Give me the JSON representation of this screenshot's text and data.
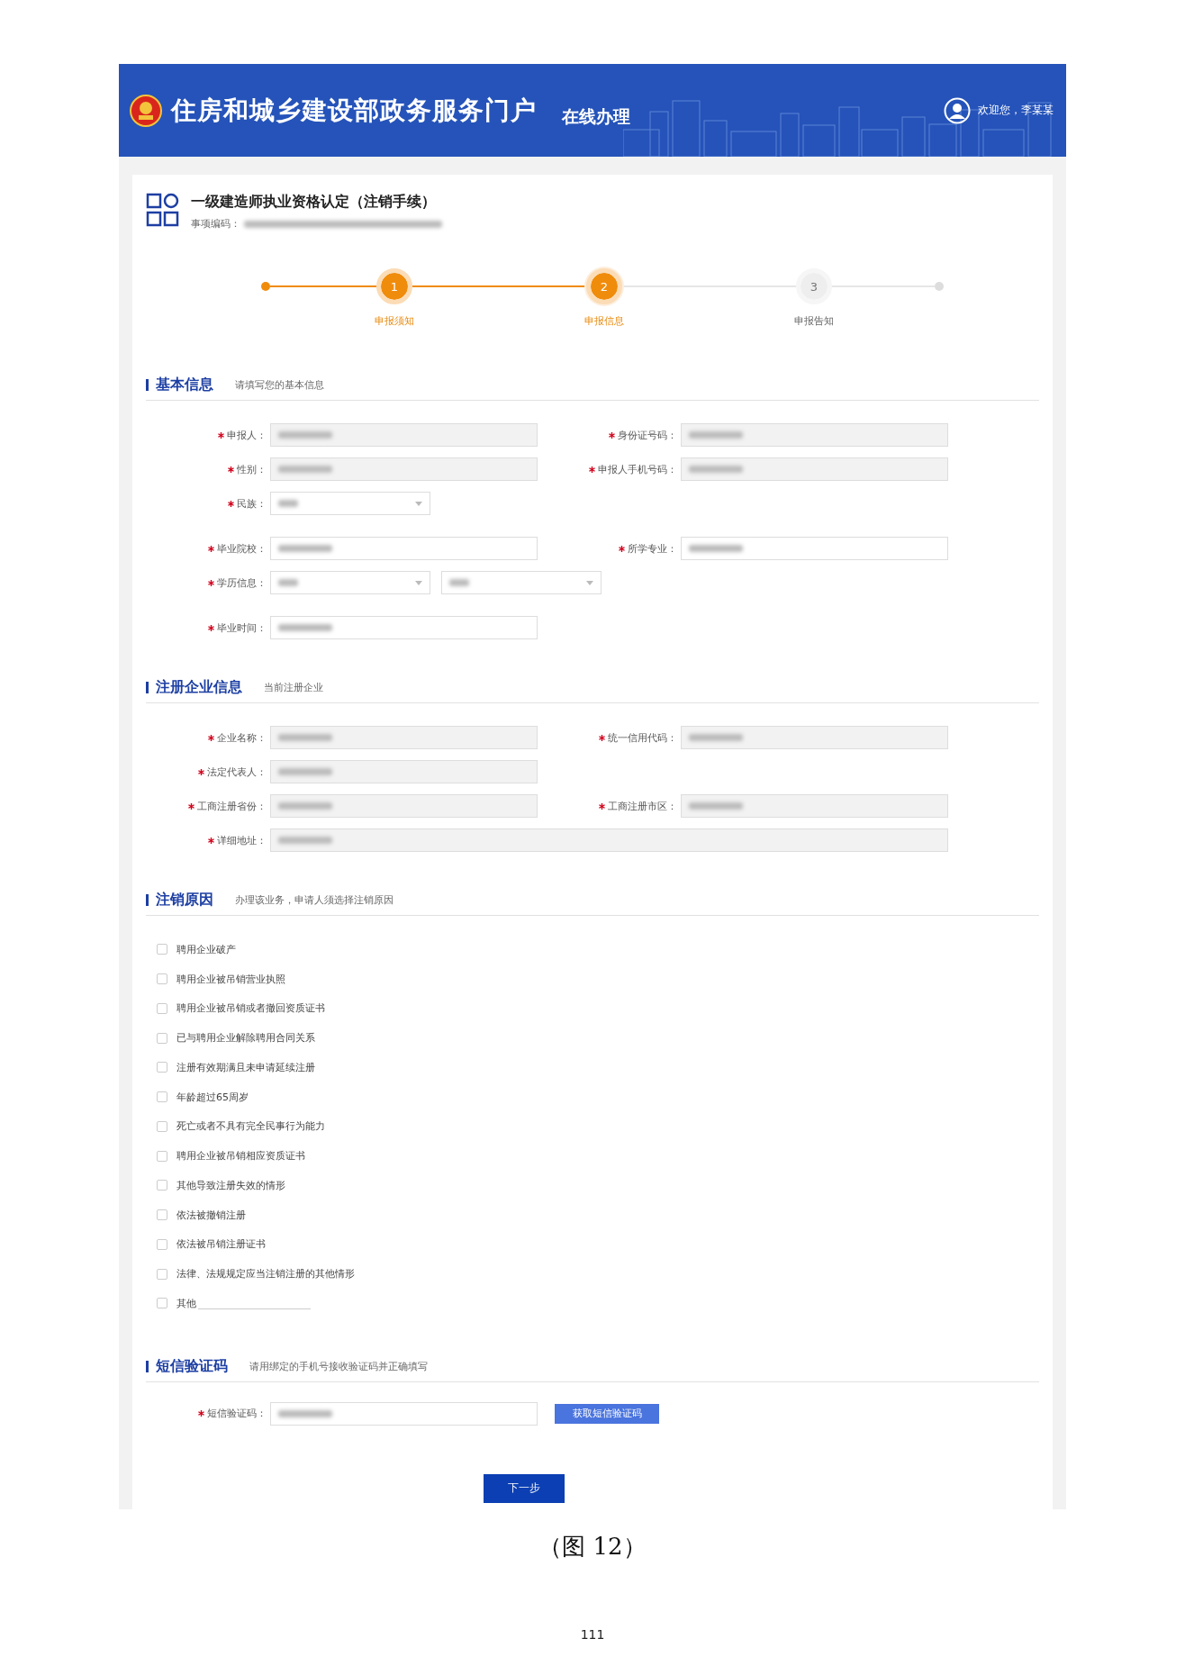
{
  "header": {
    "title": "住房和城乡建设部政务服务门户",
    "subtitle": "在线办理",
    "welcome": "欢迎您，李某某"
  },
  "item": {
    "title": "一级建造师执业资格认定（注销手续）",
    "code_label": "事项编码："
  },
  "steps": [
    {
      "number": "1",
      "label": "申报须知",
      "done": true,
      "selected": false
    },
    {
      "number": "2",
      "label": "申报信息",
      "done": false,
      "selected": true
    },
    {
      "number": "3",
      "label": "申报告知",
      "done": false,
      "selected": false
    }
  ],
  "sections": [
    {
      "kind": "form",
      "title": "基本信息",
      "hint": "请填写您的基本信息",
      "groups": [
        [
          [
            {
              "label": "申报人：",
              "required": true,
              "controls": [
                {
                  "kind": "input",
                  "readonly": true,
                  "blurred": true
                }
              ]
            },
            {
              "label": "身份证号码：",
              "required": true,
              "controls": [
                {
                  "kind": "input",
                  "readonly": true,
                  "blurred": true
                }
              ]
            }
          ],
          [
            {
              "label": "性别：",
              "required": true,
              "controls": [
                {
                  "kind": "input",
                  "readonly": true,
                  "blurred": true
                }
              ]
            },
            {
              "label": "申报人手机号码：",
              "required": true,
              "controls": [
                {
                  "kind": "input",
                  "readonly": true,
                  "blurred": true
                }
              ]
            }
          ],
          [
            {
              "label": "民族：",
              "required": true,
              "controls": [
                {
                  "kind": "select",
                  "readonly": false,
                  "blurred": true
                }
              ]
            }
          ]
        ],
        [
          [
            {
              "label": "毕业院校：",
              "required": true,
              "controls": [
                {
                  "kind": "input",
                  "readonly": false,
                  "blurred": true
                }
              ]
            },
            {
              "label": "所学专业：",
              "required": true,
              "controls": [
                {
                  "kind": "input",
                  "readonly": false,
                  "blurred": true
                }
              ]
            }
          ],
          [
            {
              "label": "学历信息：",
              "required": true,
              "controls": [
                {
                  "kind": "select",
                  "readonly": false,
                  "blurred": true
                },
                {
                  "kind": "select",
                  "readonly": false,
                  "blurred": true
                }
              ]
            }
          ]
        ],
        [
          [
            {
              "label": "毕业时间：",
              "required": true,
              "controls": [
                {
                  "kind": "input",
                  "readonly": false,
                  "blurred": true
                }
              ]
            }
          ]
        ]
      ]
    },
    {
      "kind": "form",
      "title": "注册企业信息",
      "hint": "当前注册企业",
      "groups": [
        [
          [
            {
              "label": "企业名称：",
              "required": true,
              "controls": [
                {
                  "kind": "input",
                  "readonly": true,
                  "blurred": true
                }
              ]
            },
            {
              "label": "统一信用代码：",
              "required": true,
              "controls": [
                {
                  "kind": "input",
                  "readonly": true,
                  "blurred": true
                }
              ]
            }
          ],
          [
            {
              "label": "法定代表人：",
              "required": true,
              "controls": [
                {
                  "kind": "input",
                  "readonly": true,
                  "blurred": true
                }
              ]
            }
          ],
          [
            {
              "label": "工商注册省份：",
              "required": true,
              "controls": [
                {
                  "kind": "input",
                  "readonly": true,
                  "blurred": true
                }
              ]
            },
            {
              "label": "工商注册市区：",
              "required": true,
              "controls": [
                {
                  "kind": "input",
                  "readonly": true,
                  "blurred": true
                }
              ]
            }
          ],
          [
            {
              "label": "详细地址：",
              "required": true,
              "controls": [
                {
                  "kind": "wide-input",
                  "readonly": true,
                  "blurred": true
                }
              ]
            }
          ]
        ]
      ]
    },
    {
      "kind": "checklist",
      "title": "注销原因",
      "hint": "办理该业务，申请人须选择注销原因",
      "options": [
        {
          "label": "聘用企业破产",
          "checked": false,
          "kind": "plain"
        },
        {
          "label": "聘用企业被吊销营业执照",
          "checked": false,
          "kind": "plain"
        },
        {
          "label": "聘用企业被吊销或者撤回资质证书",
          "checked": false,
          "kind": "plain"
        },
        {
          "label": "已与聘用企业解除聘用合同关系",
          "checked": false,
          "kind": "plain"
        },
        {
          "label": "注册有效期满且未申请延续注册",
          "checked": false,
          "kind": "plain"
        },
        {
          "label": "年龄超过65周岁",
          "checked": false,
          "kind": "plain"
        },
        {
          "label": "死亡或者不具有完全民事行为能力",
          "checked": false,
          "kind": "plain"
        },
        {
          "label": "聘用企业被吊销相应资质证书",
          "checked": false,
          "kind": "plain"
        },
        {
          "label": "其他导致注册失效的情形",
          "checked": false,
          "kind": "plain"
        },
        {
          "label": "依法被撤销注册",
          "checked": false,
          "kind": "plain"
        },
        {
          "label": "依法被吊销注册证书",
          "checked": false,
          "kind": "plain"
        },
        {
          "label": "法律、法规规定应当注销注册的其他情形",
          "checked": false,
          "kind": "plain"
        },
        {
          "label": "其他",
          "checked": false,
          "kind": "with-line"
        }
      ]
    },
    {
      "kind": "sms",
      "title": "短信验证码",
      "hint": "请用绑定的手机号接收验证码并正确填写",
      "field": {
        "label": "短信验证码：",
        "required": true,
        "controls": [
          {
            "kind": "input",
            "readonly": false,
            "blurred": true
          }
        ]
      },
      "button": "获取短信验证码"
    }
  ],
  "next_button": "下一步",
  "caption": "（图 12）",
  "page_number": "111"
}
